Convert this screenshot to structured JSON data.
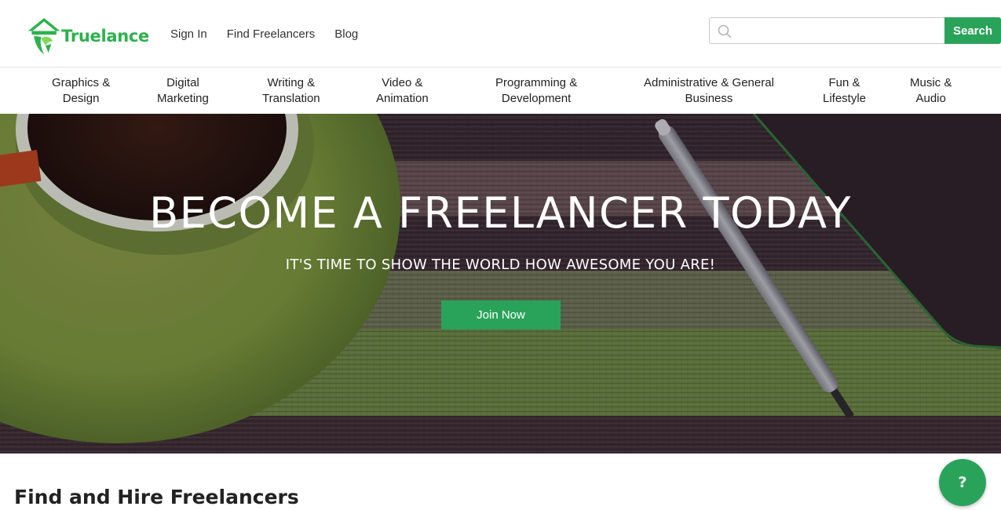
{
  "brand": {
    "name": "Truelance",
    "color": "#2bb24c"
  },
  "top_nav": {
    "sign_in": "Sign In",
    "find_freelancers": "Find Freelancers",
    "blog": "Blog"
  },
  "search": {
    "placeholder": "",
    "value": "",
    "button_label": "Search",
    "icon": "search-icon"
  },
  "categories": [
    "Graphics &\nDesign",
    "Digital\nMarketing",
    "Writing &\nTranslation",
    "Video &\nAnimation",
    "Programming &\nDevelopment",
    "Administrative & General\nBusiness",
    "Fun &\nLifestyle",
    "Music &\nAudio"
  ],
  "hero": {
    "title": "BECOME A FREELANCER TODAY",
    "subtitle": "IT'S TIME TO SHOW THE WORLD HOW AWESOME YOU ARE!",
    "cta_label": "Join Now"
  },
  "section": {
    "title": "Find and Hire Freelancers"
  },
  "help": {
    "label": "?",
    "icon": "help-icon"
  },
  "colors": {
    "accent": "#2aa35a",
    "hero_dark": "#3a2d36",
    "hero_green": "#6f8a45"
  }
}
